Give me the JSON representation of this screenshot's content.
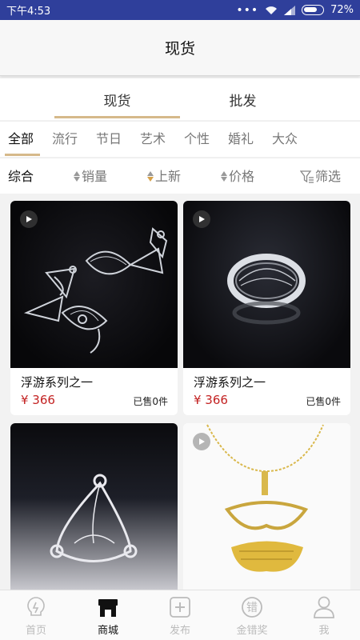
{
  "status_bar": {
    "time": "下午4:53",
    "battery": "72%"
  },
  "header": {
    "title": "现货"
  },
  "tabs": [
    {
      "label": "现货",
      "active": true
    },
    {
      "label": "批发",
      "active": false
    }
  ],
  "categories": [
    "全部",
    "流行",
    "节日",
    "艺术",
    "个性",
    "婚礼",
    "大众"
  ],
  "active_category": "全部",
  "sort": {
    "comprehensive": "综合",
    "sales": "销量",
    "newest": "上新",
    "price": "价格",
    "filter": "筛选"
  },
  "products": [
    {
      "name": "浮游系列之一",
      "price": "¥ 366",
      "sold": "已售0件",
      "has_video": true
    },
    {
      "name": "浮游系列之一",
      "price": "¥ 366",
      "sold": "已售0件",
      "has_video": true
    },
    {
      "has_video": false
    },
    {
      "has_video": true
    }
  ],
  "bottom_nav": [
    {
      "label": "首页",
      "icon": "lightbulb-icon",
      "active": false
    },
    {
      "label": "商城",
      "icon": "store-icon",
      "active": true
    },
    {
      "label": "发布",
      "icon": "plus-square-icon",
      "active": false
    },
    {
      "label": "金错奖",
      "icon": "award-badge-icon",
      "badge_char": "错",
      "active": false
    },
    {
      "label": "我",
      "icon": "user-icon",
      "active": false
    }
  ],
  "colors": {
    "status_bar": "#2f3f9b",
    "accent": "#d6b98a",
    "price": "#c32222"
  }
}
